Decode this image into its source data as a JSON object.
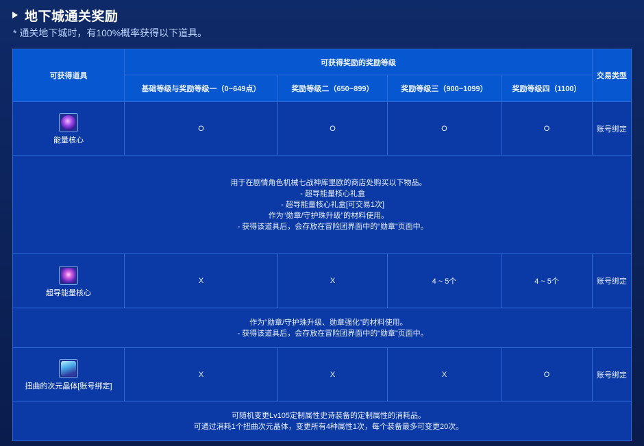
{
  "header": {
    "title": "地下城通关奖励",
    "subtitle": "* 通关地下城时，有100%概率获得以下道具。"
  },
  "table": {
    "col_item": "可获得道具",
    "col_levels": "可获得奖励的奖励等级",
    "col_trade": "交易类型",
    "levels": [
      "基础等级与奖励等级一（0~649点）",
      "奖励等级二（650~899）",
      "奖励等级三（900~1099）",
      "奖励等级四（1100）"
    ],
    "rows": [
      {
        "name": "能量核心",
        "icon": "energy-core-icon",
        "values": [
          "O",
          "O",
          "O",
          "O"
        ],
        "trade": "账号绑定",
        "desc": [
          "用于在剧情角色机械七战神库里欧的商店处购买以下物品。",
          "    - 超导能量核心礼盒",
          "    - 超导能量核心礼盒[可交易1次]",
          "作为“勋章/守护珠升级”的材料使用。",
          "    - 获得该道具后，会存放在冒险团界面中的“勋章”页面中。"
        ]
      },
      {
        "name": "超导能量核心",
        "icon": "superconducting-core-icon",
        "values": [
          "X",
          "X",
          "4 ~ 5个",
          "4 ~ 5个"
        ],
        "trade": "账号绑定",
        "desc": [
          "作为“勋章/守护珠升级、勋章强化”的材料使用。",
          "    - 获得该道具后，会存放在冒险团界面中的“勋章”页面中。"
        ]
      },
      {
        "name": "扭曲的次元晶体[账号绑定]",
        "icon": "distorted-crystal-icon",
        "values": [
          "X",
          "X",
          "X",
          "O"
        ],
        "trade": "账号绑定",
        "desc": [
          "可随机变更Lv105定制属性史诗装备的定制属性的消耗品。",
          "可通过消耗1个扭曲次元晶体，变更所有4种属性1次，每个装备最多可变更20次。"
        ]
      }
    ]
  }
}
